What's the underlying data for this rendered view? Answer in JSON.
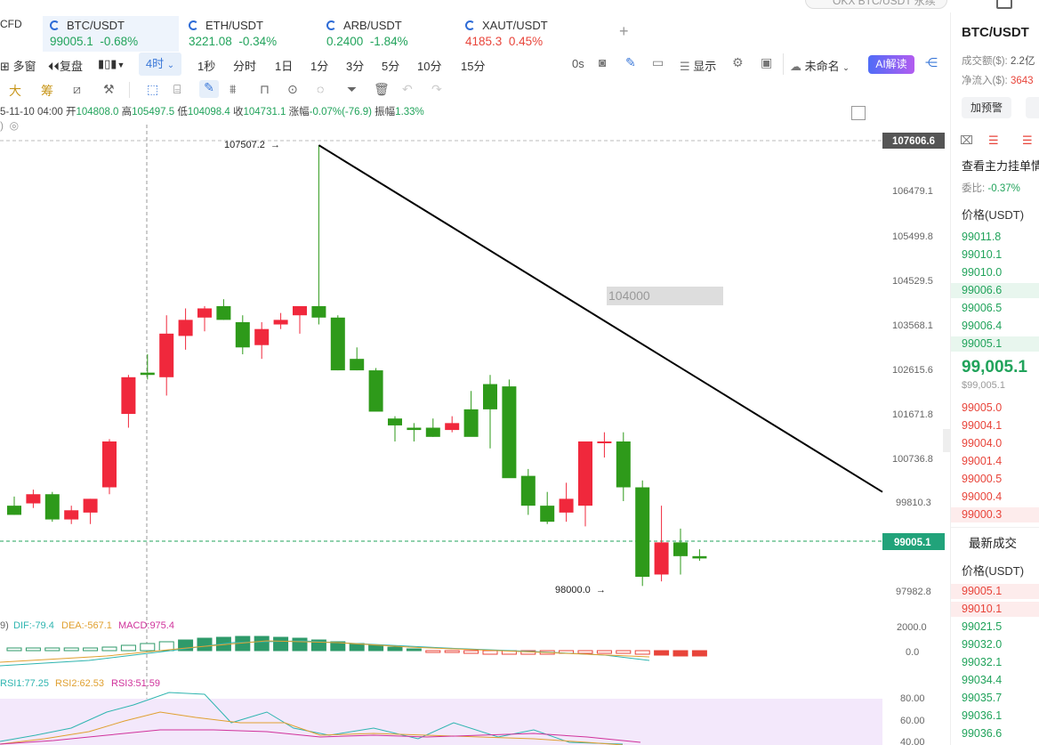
{
  "search": {
    "placeholder": "OKX BTC/USDT 永续"
  },
  "tabs": [
    {
      "symbol": "CFD",
      "price": "",
      "change": ""
    },
    {
      "symbol": "BTC/USDT",
      "price": "99005.1",
      "change": "-0.68%",
      "color": "#21a35b"
    },
    {
      "symbol": "ETH/USDT",
      "price": "3221.08",
      "change": "-0.34%",
      "color": "#21a35b"
    },
    {
      "symbol": "ARB/USDT",
      "price": "0.2400",
      "change": "-1.84%",
      "color": "#21a35b"
    },
    {
      "symbol": "XAUT/USDT",
      "price": "4185.3",
      "change": "0.45%",
      "color": "#e8443a"
    }
  ],
  "add_tab": "+",
  "toolbar": {
    "multi": "多窗",
    "replay": "复盘",
    "timeframe": "4时",
    "intervals": [
      "1秒",
      "分时",
      "1日",
      "1分",
      "3分",
      "5分",
      "10分",
      "15分"
    ],
    "countdown": "0s",
    "display": "显示",
    "unnamed": "未命名",
    "ai": "AI解读"
  },
  "drawbar": {
    "big": "大",
    "chip": "筹"
  },
  "ohlc": {
    "date": "5-11-10 04:00",
    "open_label": "开",
    "open": "104808.0",
    "high_label": "高",
    "high": "105497.5",
    "low_label": "低",
    "low": "104098.4",
    "close_label": "收",
    "close": "104731.1",
    "change_label": "涨幅",
    "change": "-0.07%(-76.9)",
    "amp_label": "振幅",
    "amp": "1.33%"
  },
  "annotations": {
    "high": "107507.2",
    "low": "98000.0",
    "level": "104000"
  },
  "price_axis": {
    "ticks": [
      "106479.1",
      "105499.8",
      "104529.5",
      "103568.1",
      "102615.6",
      "101671.8",
      "100736.8",
      "99810.3",
      "97982.8"
    ],
    "tag_top": "107606.6",
    "tag_current": "99005.1"
  },
  "macd": {
    "prefix": "9)",
    "dif": "DIF:-79.4",
    "dea": "DEA:-567.1",
    "macd": "MACD:975.4",
    "ticks": [
      "2000.0",
      "0.0"
    ]
  },
  "rsi": {
    "rsi1": "RSI1:77.25",
    "rsi2": "RSI2:62.53",
    "rsi3": "RSI3:51.59",
    "ticks": [
      "80.00",
      "60.00",
      "40.00"
    ]
  },
  "chart_data": {
    "type": "candlestick",
    "timeframe": "4h",
    "ylim": [
      97500,
      108000
    ],
    "candles": [
      {
        "o": 99650,
        "h": 99850,
        "l": 99450,
        "c": 99450
      },
      {
        "o": 99700,
        "h": 100000,
        "l": 99600,
        "c": 99900
      },
      {
        "o": 99900,
        "h": 99950,
        "l": 99300,
        "c": 99350
      },
      {
        "o": 99350,
        "h": 99650,
        "l": 99250,
        "c": 99550
      },
      {
        "o": 99500,
        "h": 99800,
        "l": 99250,
        "c": 99800
      },
      {
        "o": 100050,
        "h": 101100,
        "l": 99900,
        "c": 101050
      },
      {
        "o": 101650,
        "h": 102500,
        "l": 101350,
        "c": 102450
      },
      {
        "o": 102550,
        "h": 102950,
        "l": 102400,
        "c": 102500
      },
      {
        "o": 102450,
        "h": 103800,
        "l": 102050,
        "c": 103400
      },
      {
        "o": 103350,
        "h": 103950,
        "l": 103050,
        "c": 103700
      },
      {
        "o": 103750,
        "h": 104000,
        "l": 103450,
        "c": 103950
      },
      {
        "o": 104000,
        "h": 104150,
        "l": 103700,
        "c": 103700
      },
      {
        "o": 103650,
        "h": 103800,
        "l": 102950,
        "c": 103100
      },
      {
        "o": 103150,
        "h": 103650,
        "l": 102850,
        "c": 103500
      },
      {
        "o": 103600,
        "h": 103850,
        "l": 103500,
        "c": 103700
      },
      {
        "o": 103800,
        "h": 103850,
        "l": 103400,
        "c": 104000
      },
      {
        "o": 104000,
        "h": 107507.2,
        "l": 103600,
        "c": 103750
      },
      {
        "o": 103750,
        "h": 103800,
        "l": 102600,
        "c": 102600
      },
      {
        "o": 102850,
        "h": 103100,
        "l": 102600,
        "c": 102600
      },
      {
        "o": 102600,
        "h": 102650,
        "l": 101750,
        "c": 101700
      },
      {
        "o": 101550,
        "h": 101600,
        "l": 101050,
        "c": 101400
      },
      {
        "o": 101350,
        "h": 101450,
        "l": 101050,
        "c": 101300
      },
      {
        "o": 101350,
        "h": 101550,
        "l": 101150,
        "c": 101150
      },
      {
        "o": 101300,
        "h": 101600,
        "l": 101250,
        "c": 101450
      },
      {
        "o": 101750,
        "h": 102150,
        "l": 101300,
        "c": 101150
      },
      {
        "o": 102300,
        "h": 102500,
        "l": 100900,
        "c": 101750
      },
      {
        "o": 102250,
        "h": 102400,
        "l": 100800,
        "c": 100250
      },
      {
        "o": 100300,
        "h": 100450,
        "l": 99450,
        "c": 99650
      },
      {
        "o": 99650,
        "h": 99950,
        "l": 99250,
        "c": 99300
      },
      {
        "o": 99500,
        "h": 100150,
        "l": 99300,
        "c": 99800
      },
      {
        "o": 99650,
        "h": 100950,
        "l": 99200,
        "c": 101050
      },
      {
        "o": 101050,
        "h": 101250,
        "l": 100700,
        "c": 101050
      },
      {
        "o": 101050,
        "h": 101250,
        "l": 99750,
        "c": 100050
      },
      {
        "o": 100050,
        "h": 100200,
        "l": 97900,
        "c": 98100
      },
      {
        "o": 98150,
        "h": 99650,
        "l": 98000.0,
        "c": 98850
      },
      {
        "o": 98850,
        "h": 99150,
        "l": 98150,
        "c": 98550
      },
      {
        "o": 98550,
        "h": 98700,
        "l": 98450,
        "c": 98500
      }
    ],
    "trendline": {
      "from": {
        "index": 16,
        "price": 107507.2
      },
      "to_price_at_right": 99950
    },
    "current_price": 99005.1
  },
  "right_panel": {
    "symbol": "BTC/USDT",
    "turnover_label": "成交额($):",
    "turnover": "2.2亿",
    "inflow_label": "净流入($):",
    "inflow": "3643",
    "alert_button": "加预警",
    "depth_title": "查看主力挂单情",
    "ratio_label": "委比:",
    "ratio": "-0.37%",
    "price_header": "价格(USDT)",
    "bids_top": [
      "99011.8",
      "99010.1",
      "99010.0",
      "99006.6",
      "99006.5",
      "99006.4",
      "99005.1"
    ],
    "last_price": "99,005.1",
    "last_price_usd": "$99,005.1",
    "asks": [
      "99005.0",
      "99004.1",
      "99004.0",
      "99001.4",
      "99000.5",
      "99000.4",
      "99000.3"
    ],
    "trades_title": "最新成交",
    "trades_header": "价格(USDT)",
    "trades": [
      {
        "p": "99005.1",
        "c": "#e8443a"
      },
      {
        "p": "99010.1",
        "c": "#e8443a"
      },
      {
        "p": "99021.5",
        "c": "#21a35b"
      },
      {
        "p": "99032.0",
        "c": "#21a35b"
      },
      {
        "p": "99032.1",
        "c": "#21a35b"
      },
      {
        "p": "99034.4",
        "c": "#21a35b"
      },
      {
        "p": "99035.7",
        "c": "#21a35b"
      },
      {
        "p": "99036.1",
        "c": "#21a35b"
      },
      {
        "p": "99036.6",
        "c": "#21a35b"
      }
    ]
  },
  "colors": {
    "up": "#f0283c",
    "down": "#2e9a1a",
    "accent": "#3b78d8",
    "green_text": "#21a35b",
    "red_text": "#e8443a"
  }
}
